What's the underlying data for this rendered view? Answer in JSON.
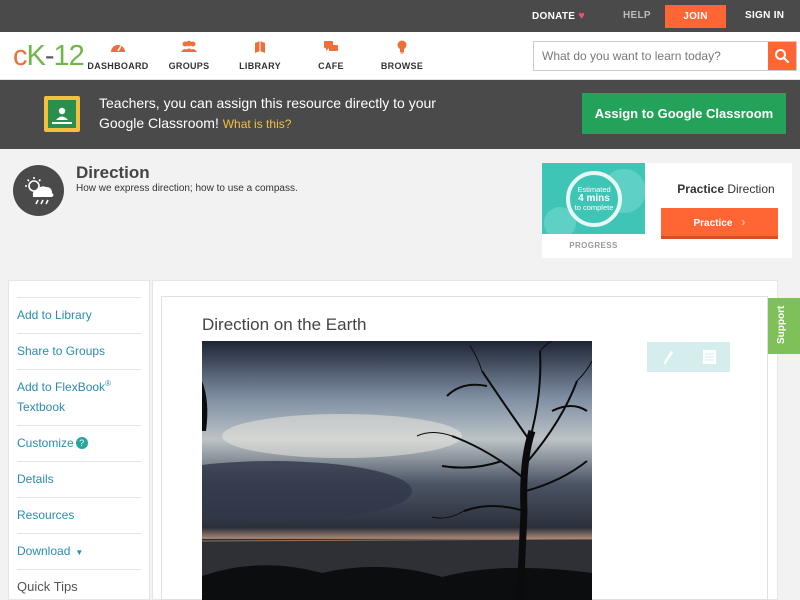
{
  "topbar": {
    "donate": "DONATE",
    "help": "HELP",
    "join": "JOIN",
    "sign_in": "SIGN IN"
  },
  "logo": {
    "c": "c",
    "k": "K",
    "dash": "-",
    "num": "12"
  },
  "nav": [
    {
      "label": "DASHBOARD",
      "icon": "dashboard-icon"
    },
    {
      "label": "GROUPS",
      "icon": "groups-icon"
    },
    {
      "label": "LIBRARY",
      "icon": "library-icon"
    },
    {
      "label": "CAFE",
      "icon": "cafe-icon"
    },
    {
      "label": "BROWSE",
      "icon": "browse-icon"
    }
  ],
  "search": {
    "placeholder": "What do you want to learn today?"
  },
  "banner": {
    "text": "Teachers, you can assign this resource directly to your Google Classroom!",
    "link": "What is this?",
    "assign_button": "Assign to Google Classroom"
  },
  "concept": {
    "title": "Direction",
    "subtitle": "How we express direction; how to use a compass."
  },
  "practice": {
    "estimated": "Estimated",
    "mins": "4 mins",
    "complete": "to complete",
    "progress_label": "PROGRESS",
    "title_bold": "Practice",
    "title_rest": "Direction",
    "button": "Practice"
  },
  "sidebar": {
    "add_library": "Add to Library",
    "share_groups": "Share to Groups",
    "add_flexbook_1": "Add to FlexBook",
    "add_flexbook_reg": "®",
    "add_flexbook_2": "Textbook",
    "customize": "Customize",
    "help_mark": "?",
    "details": "Details",
    "resources": "Resources",
    "download": "Download",
    "download_caret": "▼",
    "quick_tips": "Quick Tips"
  },
  "content": {
    "lesson_title": "Direction on the Earth",
    "photo": "photo of a bare tree silhouetted against a cloudy sky over a lake at dusk"
  },
  "support": "Support",
  "colors": {
    "brand_orange": "#ff6633",
    "brand_green": "#25a25a",
    "link_blue": "#2b8bb3",
    "teal": "#3fc5b6",
    "dark_bar": "#4a4a4a"
  }
}
